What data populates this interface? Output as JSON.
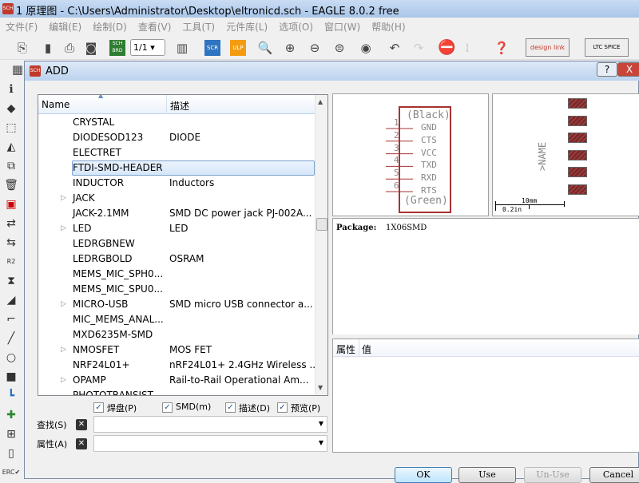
{
  "window": {
    "title": "1 原理图 - C:\\Users\\Administrator\\Desktop\\eltronicd.sch - EAGLE 8.0.2 free",
    "icon": "SCH"
  },
  "menu": [
    "文件(F)",
    "编辑(E)",
    "绘制(D)",
    "查看(V)",
    "工具(T)",
    "元件库(L)",
    "选项(O)",
    "窗口(W)",
    "帮助(H)"
  ],
  "toolbar": {
    "sheet_select": "1/1",
    "sch_brd": "SCH BRD",
    "scr": "SCR",
    "ulp": "ULP",
    "designlink": "design link",
    "ltspice": "LTC SPICE"
  },
  "dialog": {
    "title": "ADD",
    "help": "?",
    "close": "X",
    "columns": {
      "name": "Name",
      "desc": "描述"
    },
    "rows": [
      {
        "name": "CRYSTAL",
        "desc": "",
        "expandable": false
      },
      {
        "name": "DIODESOD123",
        "desc": "DIODE",
        "expandable": false
      },
      {
        "name": "ELECTRET",
        "desc": "",
        "expandable": false
      },
      {
        "name": "FTDI-SMD-HEADER",
        "desc": "",
        "expandable": false,
        "selected": true
      },
      {
        "name": "INDUCTOR",
        "desc": "Inductors",
        "expandable": false
      },
      {
        "name": "JACK",
        "desc": "",
        "expandable": true
      },
      {
        "name": "JACK-2.1MM",
        "desc": "SMD DC power jack PJ-002A...",
        "expandable": false
      },
      {
        "name": "LED",
        "desc": "LED",
        "expandable": true
      },
      {
        "name": "LEDRGBNEW",
        "desc": "",
        "expandable": false
      },
      {
        "name": "LEDRGBOLD",
        "desc": "OSRAM",
        "expandable": false
      },
      {
        "name": "MEMS_MIC_SPH0...",
        "desc": "",
        "expandable": false
      },
      {
        "name": "MEMS_MIC_SPU0...",
        "desc": "",
        "expandable": false
      },
      {
        "name": "MICRO-USB",
        "desc": "SMD micro USB connector a...",
        "expandable": true
      },
      {
        "name": "MIC_MEMS_ANAL...",
        "desc": "",
        "expandable": false
      },
      {
        "name": "MXD6235M-SMD",
        "desc": "",
        "expandable": false
      },
      {
        "name": "NMOSFET",
        "desc": "MOS FET",
        "expandable": true
      },
      {
        "name": "NRF24L01+",
        "desc": "nRF24L01+ 2.4GHz Wireless ...",
        "expandable": false
      },
      {
        "name": "OPAMP",
        "desc": "Rail-to-Rail Operational Am...",
        "expandable": true
      },
      {
        "name": "PHOTOTRANSIST",
        "desc": "",
        "expandable": false
      }
    ],
    "symbol": {
      "top": "(Black)",
      "bottom": "(Green)",
      "pins": [
        {
          "num": "1",
          "name": "GND"
        },
        {
          "num": "2",
          "name": "CTS"
        },
        {
          "num": "3",
          "name": "VCC"
        },
        {
          "num": "4",
          "name": "TXD"
        },
        {
          "num": "5",
          "name": "RXD"
        },
        {
          "num": "6",
          "name": "RTS"
        }
      ]
    },
    "footprint": {
      "name_label": ">NAME",
      "scale_mm": "10mm",
      "scale_in": "0.2in",
      "pad_count": 6
    },
    "package": {
      "label": "Package:",
      "value": "1X06SMD"
    },
    "props": {
      "col1": "属性",
      "col2": "值"
    },
    "checkboxes": [
      {
        "label": "焊盘(P)",
        "checked": true
      },
      {
        "label": "SMD(m)",
        "checked": true
      },
      {
        "label": "描述(D)",
        "checked": true
      },
      {
        "label": "预览(P)",
        "checked": true
      }
    ],
    "search": {
      "label": "查找(S)",
      "value": ""
    },
    "attribute": {
      "label": "属性(A)",
      "value": ""
    },
    "buttons": {
      "ok": "OK",
      "use": "Use",
      "unuse": "Un-Use",
      "cancel": "Cancel"
    }
  },
  "colors": {
    "symbol": "#a83232",
    "pad": "#7a2a2a"
  }
}
